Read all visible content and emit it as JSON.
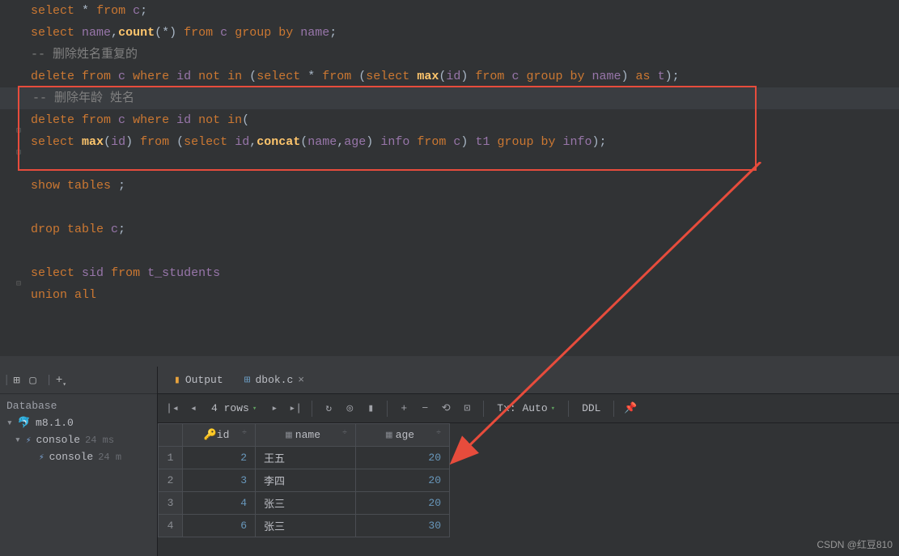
{
  "code": {
    "l1": "select * from c;",
    "l2": "select name,count(*) from c group by name;",
    "l3": "-- 删除姓名重复的",
    "l4": "delete from c where id not in (select * from (select max(id) from c group by name) as t);",
    "l5": "-- 删除年龄 姓名",
    "l6": "delete from c where id not in(",
    "l7": "select max(id) from (select id,concat(name,age) info from c) t1 group by info);",
    "l8": "show tables ;",
    "l9": "drop table c;",
    "l10": "select sid from t_students",
    "l11": "union all"
  },
  "sidebar": {
    "header": "Database",
    "items": [
      {
        "label": "m8.1.0"
      },
      {
        "label": "console",
        "time": "24 ms"
      },
      {
        "label": "console",
        "time": "24 m"
      }
    ]
  },
  "tabs": {
    "output": "Output",
    "dbok": "dbok.c"
  },
  "toolbar": {
    "rows": "4 rows",
    "tx": "Tx: Auto",
    "ddl": "DDL"
  },
  "table": {
    "columns": [
      "id",
      "name",
      "age"
    ],
    "rows": [
      {
        "n": "1",
        "id": "2",
        "name": "王五",
        "age": "20"
      },
      {
        "n": "2",
        "id": "3",
        "name": "李四",
        "age": "20"
      },
      {
        "n": "3",
        "id": "4",
        "name": "张三",
        "age": "20"
      },
      {
        "n": "4",
        "id": "6",
        "name": "张三",
        "age": "30"
      }
    ]
  },
  "watermark": "CSDN @红豆810"
}
